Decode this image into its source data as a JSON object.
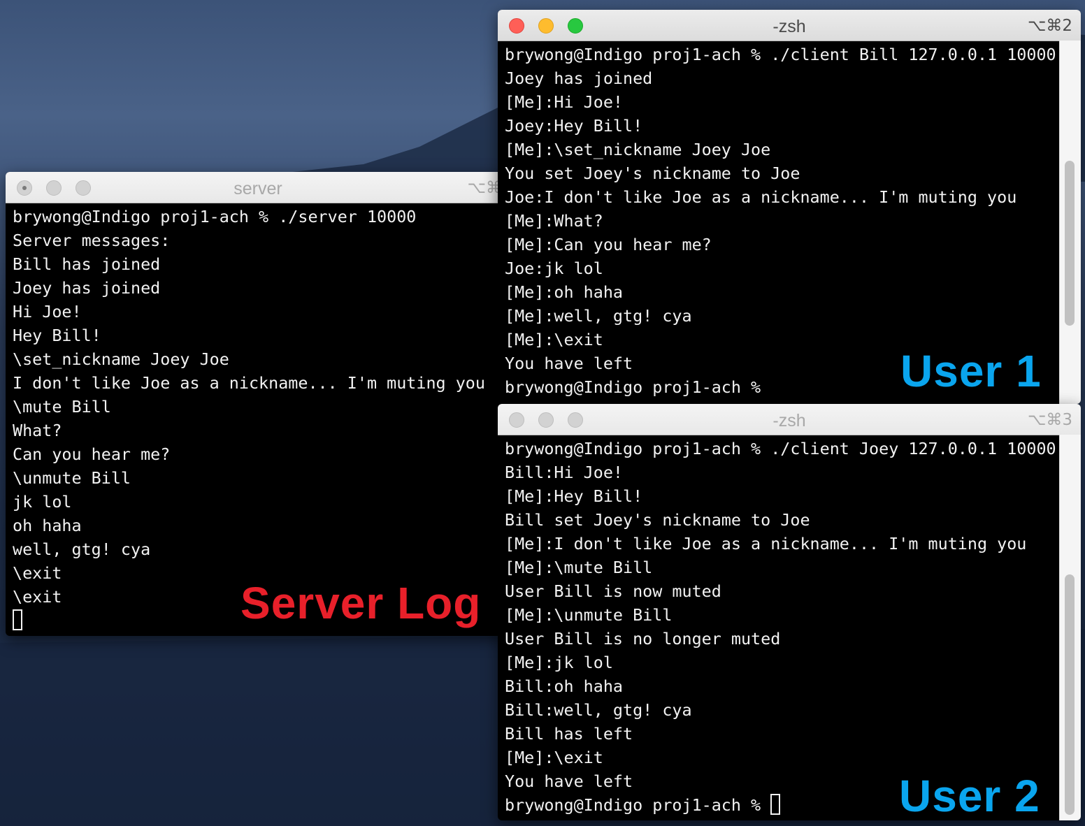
{
  "colors": {
    "server_label": "#e8202a",
    "user_label": "#0aa5ee",
    "terminal_bg": "#000000",
    "terminal_text": "#f2f2f2"
  },
  "server_window": {
    "title": "server",
    "shortcut": "⌥⌘",
    "lines": [
      "brywong@Indigo proj1-ach % ./server 10000",
      "Server messages:",
      "Bill has joined",
      "Joey has joined",
      "Hi Joe!",
      "Hey Bill!",
      "\\set_nickname Joey Joe",
      "I don't like Joe as a nickname... I'm muting you",
      "\\mute Bill",
      "What?",
      "Can you hear me?",
      "\\unmute Bill",
      "jk lol",
      "oh haha",
      "well, gtg! cya",
      "\\exit",
      "\\exit"
    ],
    "overlay_label": "Server Log"
  },
  "user1_window": {
    "title": "-zsh",
    "shortcut": "⌥⌘2",
    "lines": [
      "brywong@Indigo proj1-ach % ./client Bill 127.0.0.1 10000",
      "Joey has joined",
      "[Me]:Hi Joe!",
      "Joey:Hey Bill!",
      "[Me]:\\set_nickname Joey Joe",
      "You set Joey's nickname to Joe",
      "Joe:I don't like Joe as a nickname... I'm muting you",
      "[Me]:What?",
      "[Me]:Can you hear me?",
      "Joe:jk lol",
      "[Me]:oh haha",
      "[Me]:well, gtg! cya",
      "[Me]:\\exit",
      "You have left",
      "brywong@Indigo proj1-ach %"
    ],
    "overlay_label": "User 1"
  },
  "user2_window": {
    "title": "-zsh",
    "shortcut": "⌥⌘3",
    "lines": [
      "brywong@Indigo proj1-ach % ./client Joey 127.0.0.1 10000",
      "Bill:Hi Joe!",
      "[Me]:Hey Bill!",
      "Bill set Joey's nickname to Joe",
      "[Me]:I don't like Joe as a nickname... I'm muting you",
      "[Me]:\\mute Bill",
      "User Bill is now muted",
      "[Me]:\\unmute Bill",
      "User Bill is no longer muted",
      "[Me]:jk lol",
      "Bill:oh haha",
      "Bill:well, gtg! cya",
      "Bill has left",
      "[Me]:\\exit",
      "You have left",
      "brywong@Indigo proj1-ach % "
    ],
    "overlay_label": "User 2"
  }
}
